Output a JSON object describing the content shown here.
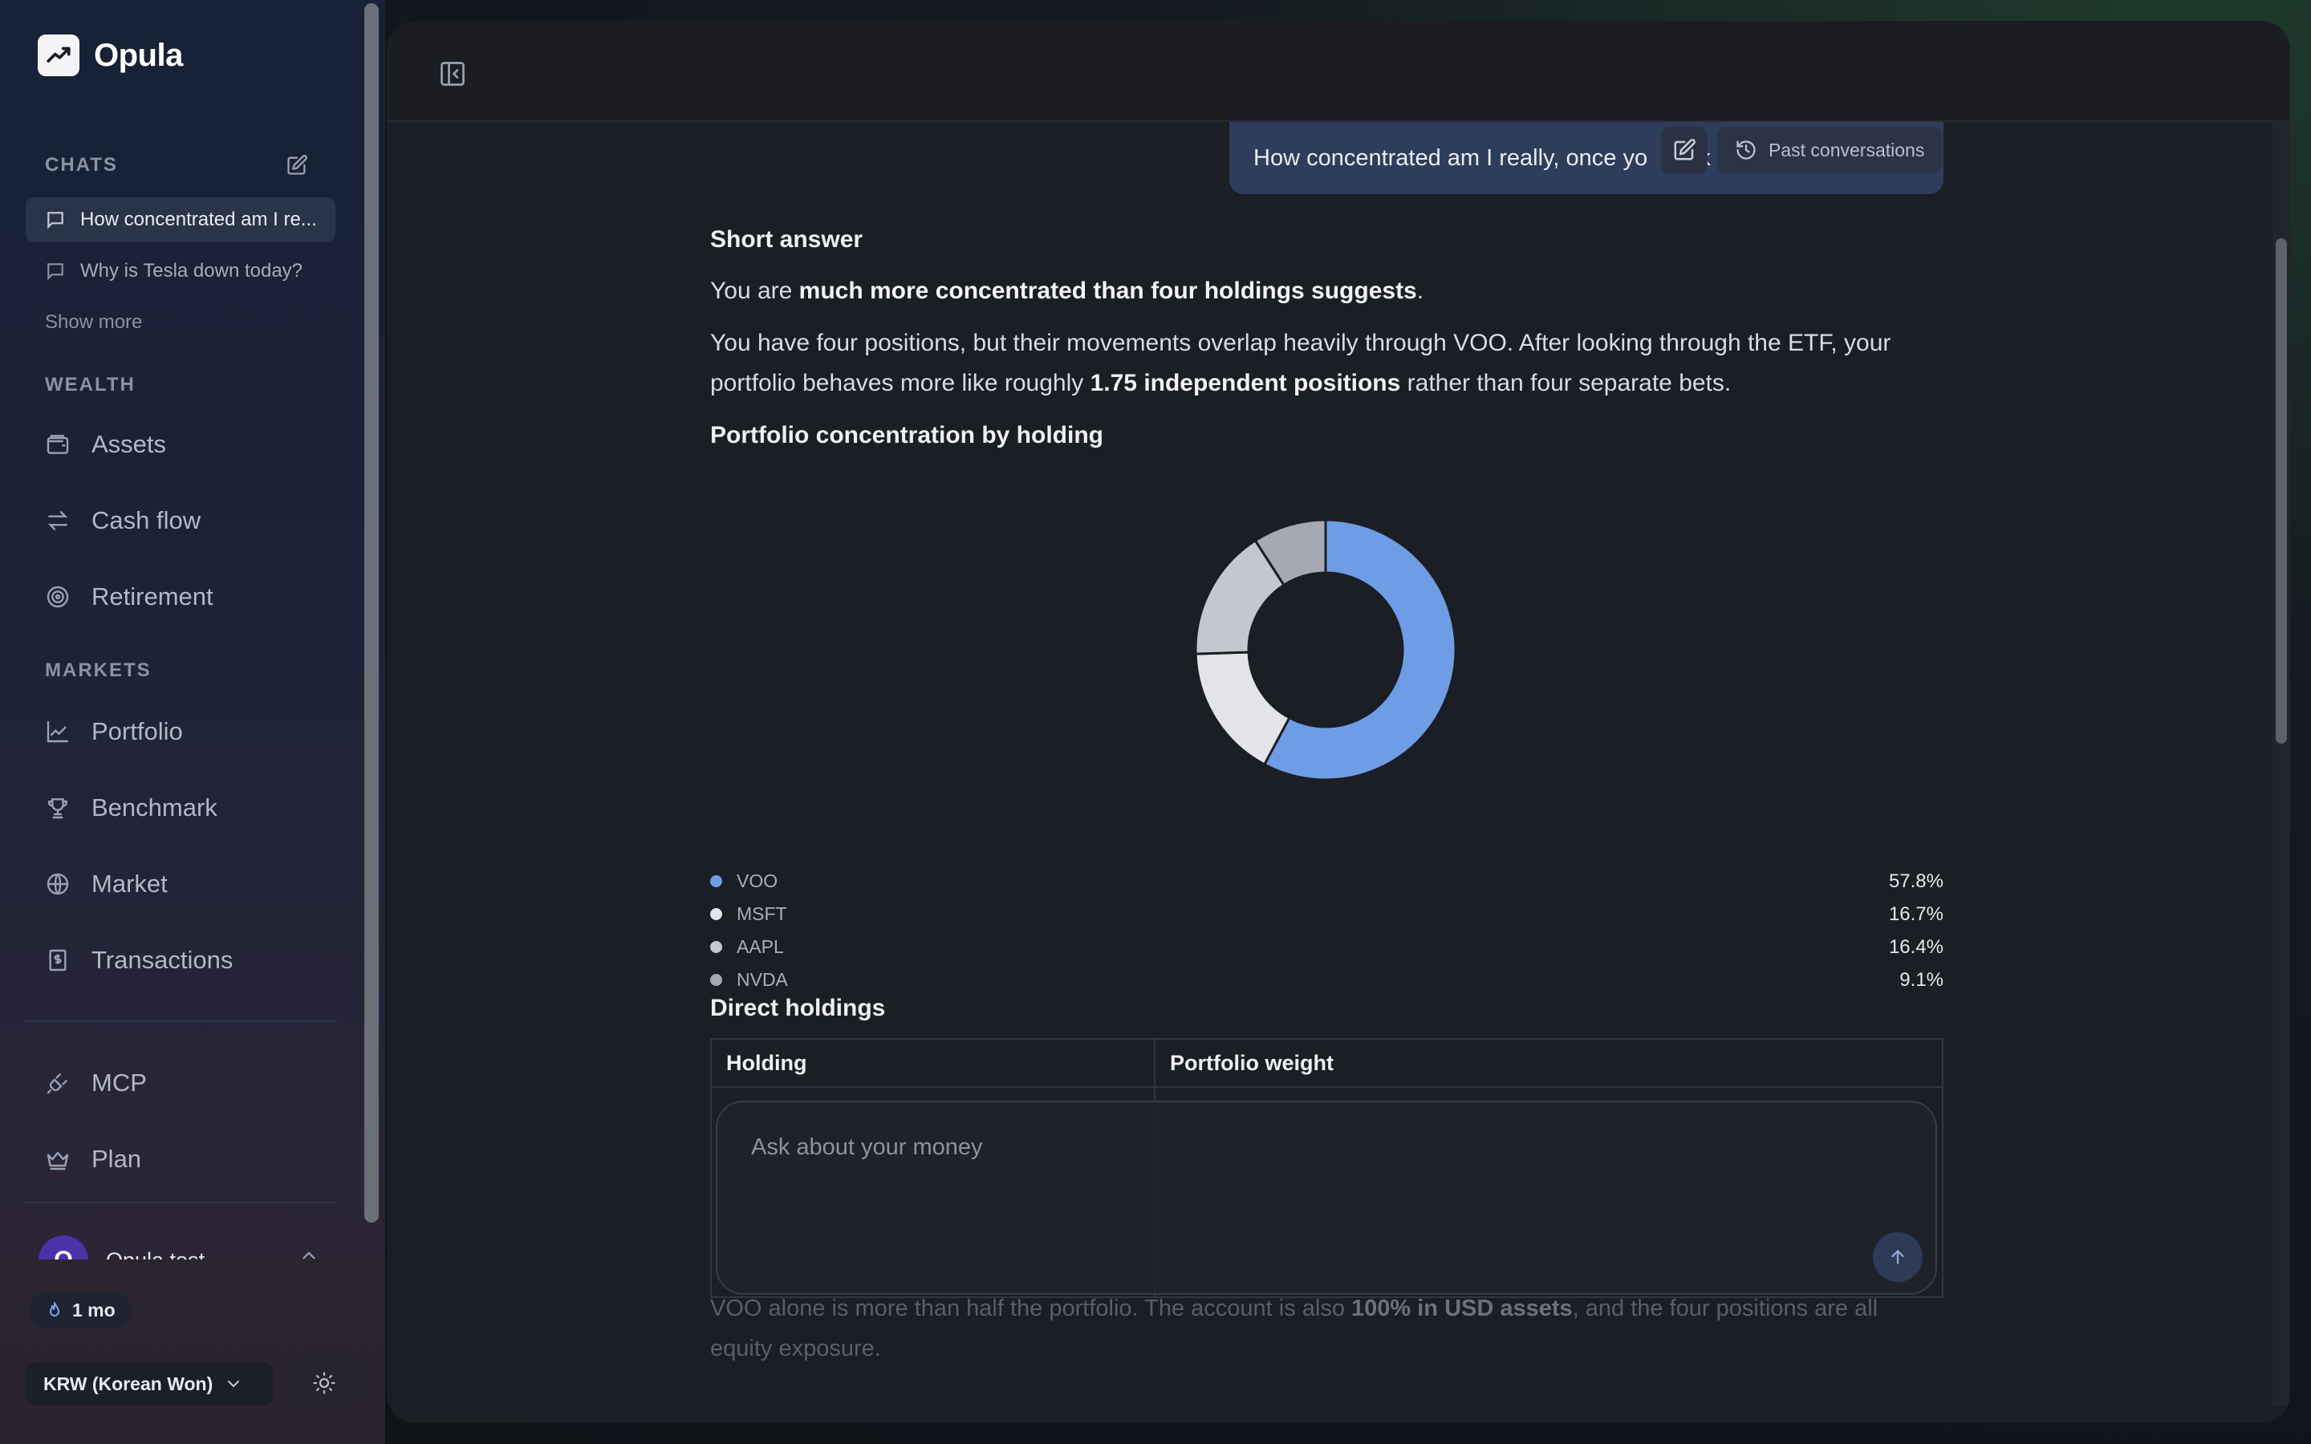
{
  "app": {
    "name": "Opula"
  },
  "sidebar": {
    "chats_label": "CHATS",
    "chats": [
      {
        "title": "How concentrated am I re...",
        "active": true
      },
      {
        "title": "Why is Tesla down today?",
        "active": false
      }
    ],
    "show_more": "Show more",
    "wealth_label": "WEALTH",
    "wealth_items": [
      {
        "label": "Assets",
        "icon": "wallet-icon"
      },
      {
        "label": "Cash flow",
        "icon": "arrows-swap-icon"
      },
      {
        "label": "Retirement",
        "icon": "target-icon"
      }
    ],
    "markets_label": "MARKETS",
    "markets_items": [
      {
        "label": "Portfolio",
        "icon": "line-chart-icon"
      },
      {
        "label": "Benchmark",
        "icon": "trophy-icon"
      },
      {
        "label": "Market",
        "icon": "globe-icon"
      },
      {
        "label": "Transactions",
        "icon": "receipt-icon"
      }
    ],
    "extra_items": [
      {
        "label": "MCP",
        "icon": "plug-icon"
      },
      {
        "label": "Plan",
        "icon": "crown-icon"
      }
    ],
    "user": {
      "initial": "O",
      "name": "Opula test"
    },
    "streak": "1 mo",
    "currency": "KRW (Korean Won)"
  },
  "conversation": {
    "user_message": "How concentrated am I really, once yo",
    "user_message_tail": "k",
    "past_conversations": "Past conversations",
    "short_answer_heading": "Short answer",
    "p1_prefix": "You are ",
    "p1_bold": "much more concentrated than four holdings suggests",
    "p1_suffix": ".",
    "p2_prefix": "You have four positions, but their movements overlap heavily through VOO. After looking through the ETF, your portfolio behaves more like roughly ",
    "p2_bold": "1.75 independent positions",
    "p2_suffix": " rather than four separate bets.",
    "chart_heading": "Portfolio concentration by holding",
    "table_heading": "Direct holdings",
    "table_headers": [
      "Holding",
      "Portfolio weight"
    ],
    "composer_placeholder": "Ask about your money",
    "trailing_prefix": "VOO alone is more than half the portfolio. The account is also ",
    "trailing_bold": "100% in USD assets",
    "trailing_suffix": ", and the four positions are all",
    "trailing_line2": "equity exposure."
  },
  "chart_data": {
    "type": "pie",
    "donut": true,
    "categories": [
      "VOO",
      "MSFT",
      "AAPL",
      "NVDA"
    ],
    "values": [
      57.8,
      16.7,
      16.4,
      9.1
    ],
    "labels": [
      "57.8%",
      "16.7%",
      "16.4%",
      "9.1%"
    ],
    "colors": [
      "#6e9de6",
      "#e3e4ea",
      "#c5c7cf",
      "#a7a9b2"
    ],
    "legend": "bottom"
  }
}
